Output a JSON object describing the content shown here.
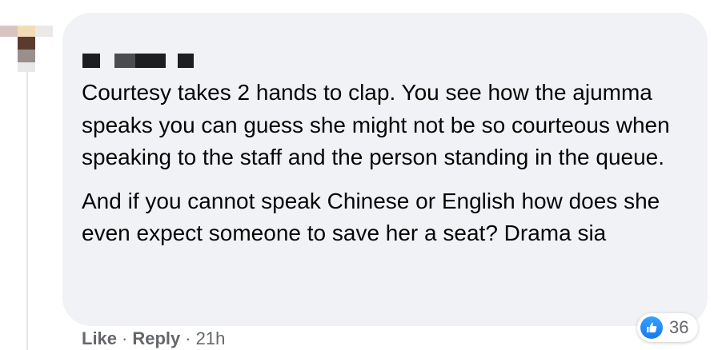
{
  "comment": {
    "paragraphs": [
      "Courtesy takes 2 hands to clap. You see how the ajumma speaks you can guess she might not be so courteous when speaking to the staff and the person standing in the queue.",
      "And if you cannot speak Chinese or English how does she even expect someone to save her a seat? Drama sia"
    ]
  },
  "actions": {
    "like_label": "Like",
    "reply_label": "Reply",
    "separator": "·",
    "timestamp": "21h"
  },
  "reactions": {
    "icon": "thumbs-up-icon",
    "count": "36",
    "color": "#1877f2"
  },
  "colors": {
    "bubble_bg": "#f0f2f5",
    "text": "#050505",
    "meta_text": "#65676b"
  }
}
